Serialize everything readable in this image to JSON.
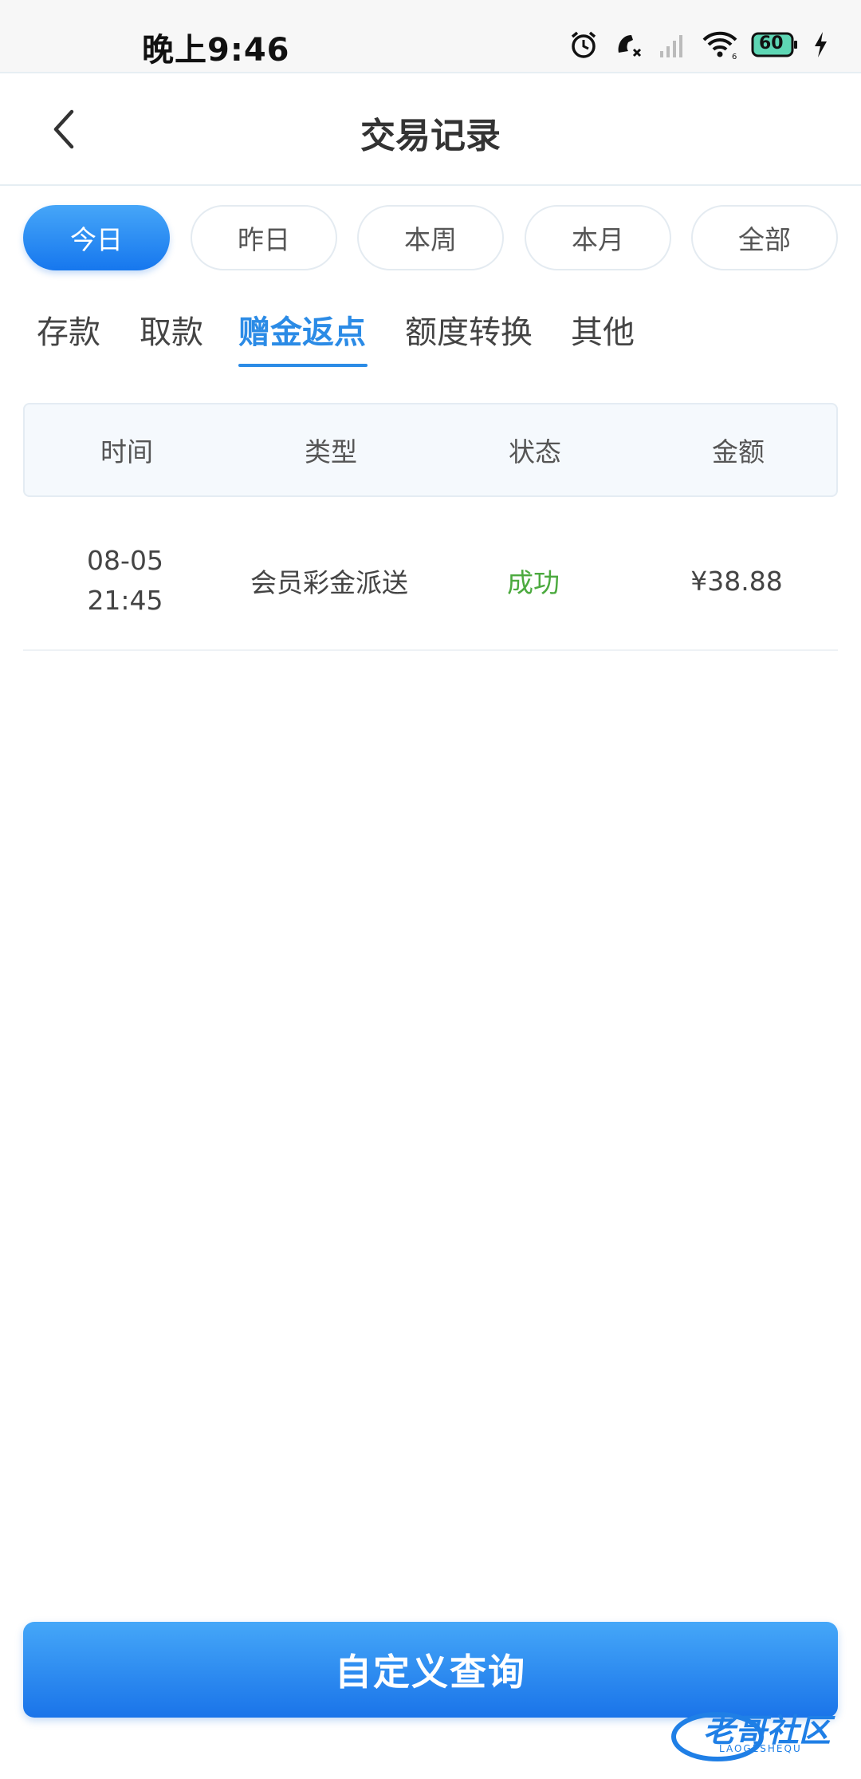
{
  "status_bar": {
    "time": "晚上9:46",
    "battery": "60"
  },
  "header": {
    "title": "交易记录"
  },
  "periods": [
    {
      "label": "今日",
      "active": true
    },
    {
      "label": "昨日",
      "active": false
    },
    {
      "label": "本周",
      "active": false
    },
    {
      "label": "本月",
      "active": false
    },
    {
      "label": "全部",
      "active": false
    }
  ],
  "categories": [
    {
      "label": "存款",
      "active": false
    },
    {
      "label": "取款",
      "active": false
    },
    {
      "label": "赠金返点",
      "active": true
    },
    {
      "label": "额度转换",
      "active": false
    },
    {
      "label": "其他",
      "active": false
    }
  ],
  "table": {
    "columns": [
      "时间",
      "类型",
      "状态",
      "金额"
    ],
    "rows": [
      {
        "date": "08-05",
        "time": "21:45",
        "type": "会员彩金派送",
        "status": "成功",
        "amount": "¥38.88"
      }
    ]
  },
  "bottom": {
    "query_label": "自定义查询"
  },
  "watermark": {
    "text": "老哥社区",
    "sub": "LAOGESHEQU"
  },
  "colors": {
    "accent": "#2b8be6",
    "success": "#4caa3f"
  }
}
